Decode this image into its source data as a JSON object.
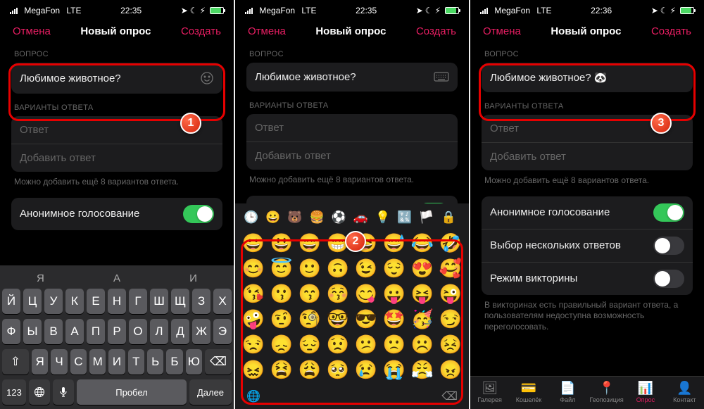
{
  "status": {
    "carrier": "MegaFon",
    "net": "LTE",
    "time1": "22:35",
    "time2": "22:35",
    "time3": "22:36",
    "batteryPct": 85
  },
  "icons": {
    "location": "➤",
    "moon": "☾",
    "bolt": "⚡︎"
  },
  "header": {
    "cancel": "Отмена",
    "title": "Новый опрос",
    "create": "Создать"
  },
  "question": {
    "label": "ВОПРОС",
    "value1": "Любимое животное?",
    "value2": "Любимое животное?",
    "value3": "Любимое животное? 🐼"
  },
  "answers": {
    "label": "ВАРИАНТЫ ОТВЕТА",
    "placeholder": "Ответ",
    "add": "Добавить ответ",
    "hint": "Можно добавить ещё 8 вариантов ответа."
  },
  "toggles": {
    "anon": "Анонимное голосование",
    "multi": "Выбор нескольких ответов",
    "quiz": "Режим викторины",
    "quizHint": "В викторинах есть правильный вариант ответа, а пользователям недоступна возможность переголосовать."
  },
  "keyboard": {
    "hints": [
      "Я",
      "А",
      "И"
    ],
    "row1": [
      "Й",
      "Ц",
      "У",
      "К",
      "Е",
      "Н",
      "Г",
      "Ш",
      "Щ",
      "З",
      "Х"
    ],
    "row2": [
      "Ф",
      "Ы",
      "В",
      "А",
      "П",
      "Р",
      "О",
      "Л",
      "Д",
      "Ж",
      "Э"
    ],
    "row3": [
      "Я",
      "Ч",
      "С",
      "М",
      "И",
      "Т",
      "Ь",
      "Б",
      "Ю"
    ],
    "shift": "⇧",
    "back": "⌫",
    "n123": "123",
    "globe": "🌐",
    "mic": "🎤",
    "space": "Пробел",
    "next": "Далее"
  },
  "emoji": {
    "cats": [
      "🕒",
      "😀",
      "🐻",
      "🍔",
      "⚽",
      "🚗",
      "💡",
      "🔣",
      "🏳️",
      "🔒"
    ],
    "grid": [
      "😀",
      "😃",
      "😄",
      "😁",
      "😆",
      "😅",
      "😂",
      "🤣",
      "😊",
      "😇",
      "🙂",
      "🙃",
      "😉",
      "😌",
      "😍",
      "🥰",
      "😘",
      "😗",
      "😙",
      "😚",
      "😋",
      "😛",
      "😝",
      "😜",
      "🤪",
      "🤨",
      "🧐",
      "🤓",
      "😎",
      "🤩",
      "🥳",
      "😏",
      "😒",
      "😞",
      "😔",
      "😟",
      "😕",
      "🙁",
      "☹️",
      "😣",
      "😖",
      "😫",
      "😩",
      "🥺",
      "😢",
      "😭",
      "😤",
      "😠"
    ],
    "globe": "🌐",
    "del": "⌫"
  },
  "tabs": {
    "gallery": "Галерея",
    "wallet": "Кошелёк",
    "file": "Файл",
    "geo": "Геопозиция",
    "poll": "Опрос",
    "contact": "Контакт"
  },
  "badges": {
    "b1": "1",
    "b2": "2",
    "b3": "3"
  }
}
